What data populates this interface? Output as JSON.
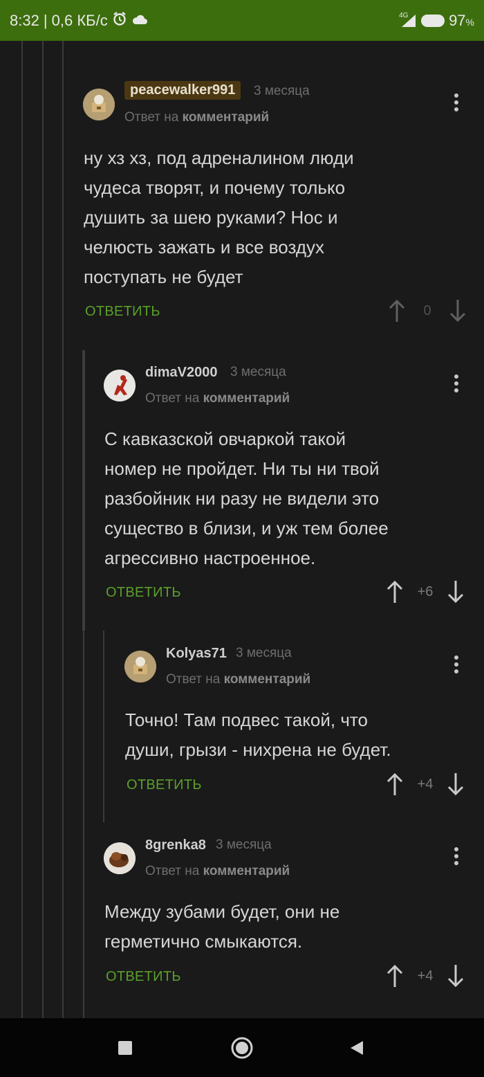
{
  "status_bar": {
    "time": "8:32",
    "speed": "| 0,6 КБ/с",
    "network": "4G",
    "battery_percent": "97",
    "battery_unit": "%",
    "icons": [
      "alarm-icon",
      "cloud-icon",
      "signal-icon",
      "battery-icon"
    ]
  },
  "comments": [
    {
      "username": "peacewalker991",
      "time": "3 месяца",
      "reply_prefix": "Ответ на",
      "reply_target": "комментарий",
      "lines": [
        "ну хз хз, под адреналином люди",
        "чудеса творят, и почему только",
        "душить за шею руками? Нос и",
        "челюсть зажать и все воздух",
        "поступать не будет"
      ],
      "reply_label": "ОТВЕТИТЬ",
      "score": "0"
    },
    {
      "username": "dimaV2000",
      "time": "3 месяца",
      "reply_prefix": "Ответ на",
      "reply_target": "комментарий",
      "lines": [
        "С кавказской овчаркой такой",
        "номер не пройдет. Ни ты ни твой",
        "разбойник ни разу не видели это",
        "существо в близи, и уж тем более",
        "агрессивно настроенное."
      ],
      "reply_label": "ОТВЕТИТЬ",
      "score": "+6"
    },
    {
      "username": "Kolyas71",
      "time": "3 месяца",
      "reply_prefix": "Ответ на",
      "reply_target": "комментарий",
      "lines": [
        "Точно! Там подвес такой, что",
        "души, грызи - нихрена не будет."
      ],
      "reply_label": "ОТВЕТИТЬ",
      "score": "+4"
    },
    {
      "username": "8grenka8",
      "time": "3 месяца",
      "reply_prefix": "Ответ на",
      "reply_target": "комментарий",
      "lines": [
        "Между зубами будет, они не",
        "герметично смыкаются."
      ],
      "reply_label": "ОТВЕТИТЬ",
      "score": "+4"
    }
  ],
  "colors": {
    "status_bar": "#3d6e0e",
    "background": "#1a1a1a",
    "reply_green": "#5ba02a",
    "highlight_username": "#4b3812"
  },
  "nav": [
    "recents-square-icon",
    "home-circle-icon",
    "back-triangle-icon"
  ]
}
